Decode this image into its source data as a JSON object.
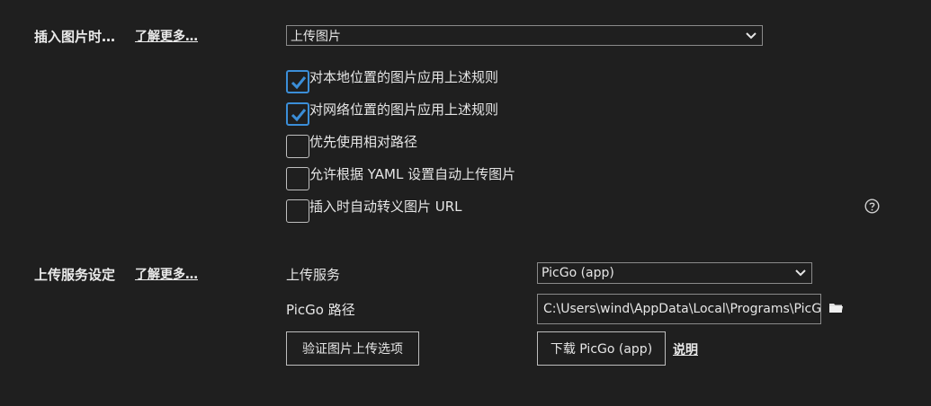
{
  "insert_image": {
    "title": "插入图片时…",
    "learn_more": "了解更多…",
    "select_value": "上传图片",
    "options": [
      {
        "label": "对本地位置的图片应用上述规则",
        "checked": true
      },
      {
        "label": "对网络位置的图片应用上述规则",
        "checked": true
      },
      {
        "label": "优先使用相对路径",
        "checked": false
      },
      {
        "label": "允许根据 YAML 设置自动上传图片",
        "checked": false
      },
      {
        "label": "插入时自动转义图片 URL",
        "checked": false
      }
    ],
    "help_icon": "question-circle-icon"
  },
  "upload_service": {
    "title": "上传服务设定",
    "learn_more": "了解更多…",
    "service_label": "上传服务",
    "service_value": "PicGo (app)",
    "path_label": "PicGo 路径",
    "path_value": "C:\\Users\\wind\\AppData\\Local\\Programs\\PicGo",
    "folder_icon": "folder-icon",
    "verify_button": "验证图片上传选项",
    "download_button": "下载 PicGo (app)",
    "explain_link": "说明"
  },
  "colors": {
    "background": "#1f1f1f",
    "checkbox_accent": "#3b8ed8",
    "text": "#e6e6e6"
  }
}
